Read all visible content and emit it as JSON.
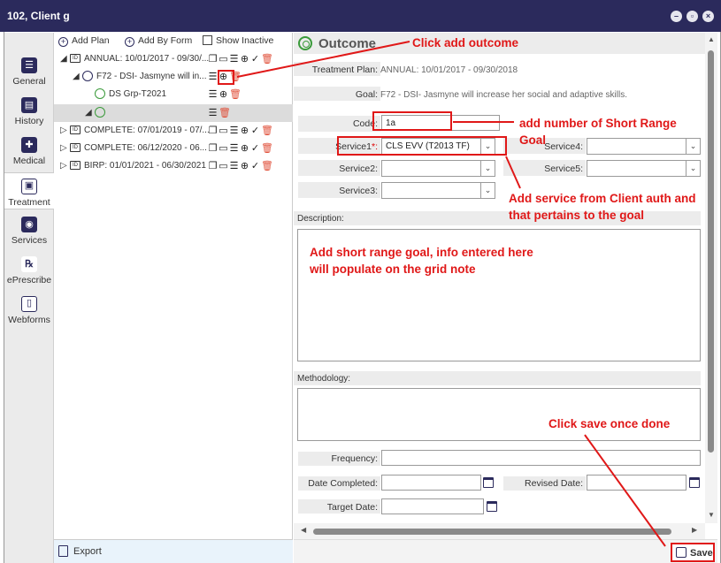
{
  "window": {
    "title": "102, Client g"
  },
  "nav": [
    {
      "label": "General",
      "icon": "person-card-icon"
    },
    {
      "label": "History",
      "icon": "clipboard-icon"
    },
    {
      "label": "Medical",
      "icon": "medical-cross-icon"
    },
    {
      "label": "Treatment",
      "icon": "id-card-icon"
    },
    {
      "label": "Services",
      "icon": "compass-icon"
    },
    {
      "label": "ePrescribe",
      "icon": "rx-icon"
    },
    {
      "label": "Webforms",
      "icon": "document-icon"
    }
  ],
  "tree": {
    "toolbar": {
      "add_plan": "Add Plan",
      "add_by_form": "Add By Form",
      "show_inactive": "Show Inactive"
    },
    "rows": [
      {
        "label": "ANNUAL: 10/01/2017 - 09/30/..."
      },
      {
        "label": "F72 - DSI- Jasmyne will in..."
      },
      {
        "label": "DS Grp-T2021"
      },
      {
        "label": ""
      },
      {
        "label": "COMPLETE: 07/01/2019 - 07/..."
      },
      {
        "label": "COMPLETE: 06/12/2020 - 06..."
      },
      {
        "label": "BIRP: 01/01/2021 - 06/30/2021"
      }
    ],
    "export_label": "Export"
  },
  "form": {
    "heading": "Outcome",
    "treatment_plan_label": "Treatment Plan:",
    "treatment_plan_value": "ANNUAL: 10/01/2017 - 09/30/2018",
    "goal_label": "Goal:",
    "goal_value": "F72 - DSI- Jasmyne will increase her social and adaptive skills.",
    "code_label": "Code:",
    "code_value": "1a",
    "service1_label": "Service1",
    "required_mark": "*:",
    "service1_value": "CLS EVV (T2013 TF)",
    "service2_label": "Service2:",
    "service3_label": "Service3:",
    "service4_label": "Service4:",
    "service5_label": "Service5:",
    "description_label": "Description:",
    "methodology_label": "Methodology:",
    "frequency_label": "Frequency:",
    "date_completed_label": "Date Completed:",
    "revised_date_label": "Revised Date:",
    "target_date_label": "Target Date:",
    "save_label": "Save"
  },
  "annotations": {
    "click_add_outcome": "Click add outcome",
    "add_number": "add number of Short Range Goal",
    "add_service": "Add service from Client auth and that pertains to the goal",
    "add_short_range": "Add short range goal, info entered here will populate on the grid note",
    "click_save": "Click save once done"
  },
  "colors": {
    "titlebar": "#2b2a5c",
    "annotation": "#e01818",
    "goal_green": "#3a9a3a",
    "delete_red": "#e0503a"
  }
}
